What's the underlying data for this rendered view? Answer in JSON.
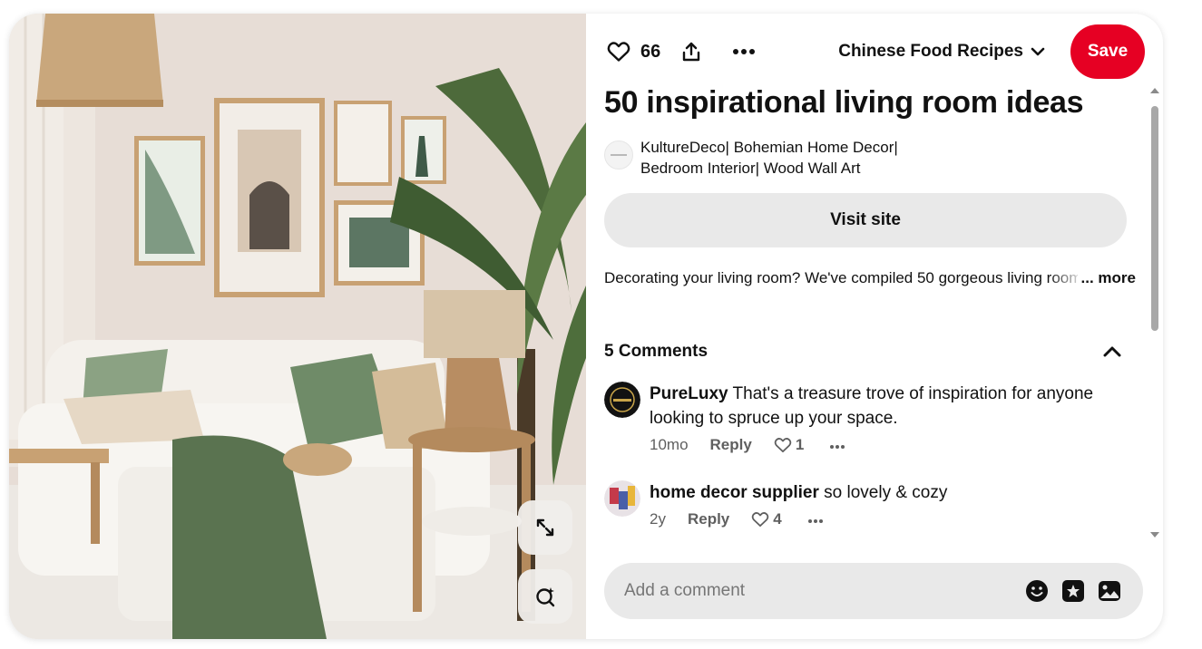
{
  "actions": {
    "like_icon": "heart-outline-icon",
    "like_count": "66",
    "share_icon": "share-upload-icon",
    "more_icon": "ellipsis-icon",
    "board_name": "Chinese Food Recipes",
    "save_label": "Save"
  },
  "pin": {
    "title": "50 inspirational living room ideas",
    "author": "KultureDeco| Bohemian Home Decor| Bedroom Interior| Wood Wall Art",
    "visit_label": "Visit site",
    "description": "Decorating your living room? We've compiled 50 gorgeous living room ideas",
    "more_label": "... more"
  },
  "comments": {
    "header": "5 Comments",
    "items": [
      {
        "user": "PureLuxy",
        "text": "That's a treasure trove of inspiration for anyone looking to spruce up your space.",
        "age": "10mo",
        "reply_label": "Reply",
        "likes": "1"
      },
      {
        "user": "home decor supplier",
        "text": "so lovely & cozy",
        "age": "2y",
        "reply_label": "Reply",
        "likes": "4"
      }
    ]
  },
  "comment_box": {
    "placeholder": "Add a comment",
    "icons": [
      "emoji-icon",
      "sticker-icon",
      "photo-icon"
    ]
  },
  "image_controls": {
    "expand_icon": "expand-arrows-icon",
    "visual_search_icon": "visual-search-icon"
  },
  "colors": {
    "save": "#e60023",
    "pill": "#e9e9e9"
  }
}
